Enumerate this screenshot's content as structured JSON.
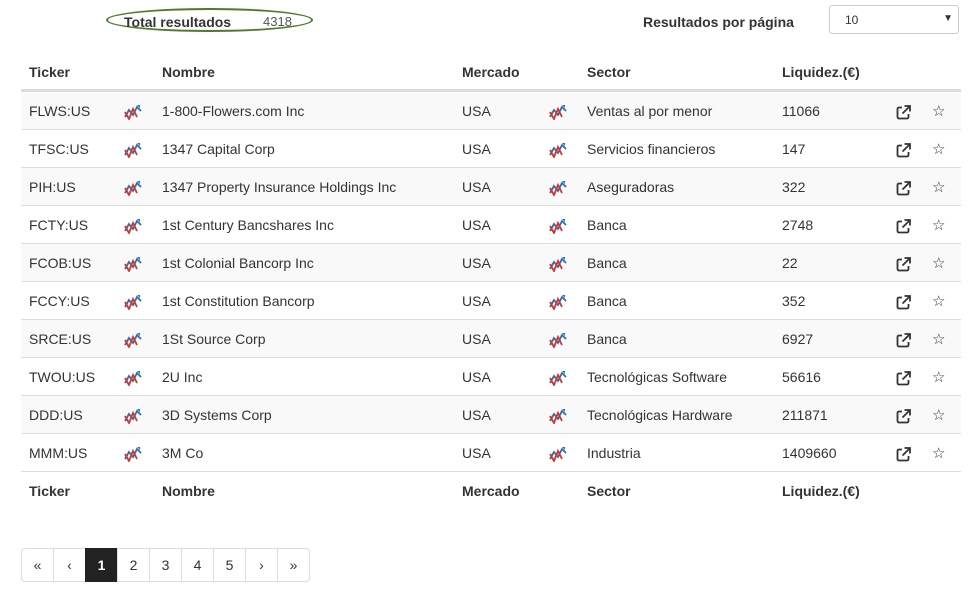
{
  "summary": {
    "total_label": "Total resultados",
    "total_value": "4318",
    "perpage_label": "Resultados por página",
    "perpage_value": "10"
  },
  "table": {
    "headers": {
      "ticker": "Ticker",
      "nombre": "Nombre",
      "mercado": "Mercado",
      "sector": "Sector",
      "liquidez": "Liquidez.(€)"
    },
    "rows": [
      {
        "ticker": "FLWS:US",
        "nombre": "1-800-Flowers.com Inc",
        "mercado": "USA",
        "sector": "Ventas al por menor",
        "liquidez": "11066"
      },
      {
        "ticker": "TFSC:US",
        "nombre": "1347 Capital Corp",
        "mercado": "USA",
        "sector": "Servicios financieros",
        "liquidez": "147"
      },
      {
        "ticker": "PIH:US",
        "nombre": "1347 Property Insurance Holdings Inc",
        "mercado": "USA",
        "sector": "Aseguradoras",
        "liquidez": "322"
      },
      {
        "ticker": "FCTY:US",
        "nombre": "1st Century Bancshares Inc",
        "mercado": "USA",
        "sector": "Banca",
        "liquidez": "2748"
      },
      {
        "ticker": "FCOB:US",
        "nombre": "1st Colonial Bancorp Inc",
        "mercado": "USA",
        "sector": "Banca",
        "liquidez": "22"
      },
      {
        "ticker": "FCCY:US",
        "nombre": "1st Constitution Bancorp",
        "mercado": "USA",
        "sector": "Banca",
        "liquidez": "352"
      },
      {
        "ticker": "SRCE:US",
        "nombre": "1St Source Corp",
        "mercado": "USA",
        "sector": "Banca",
        "liquidez": "6927"
      },
      {
        "ticker": "TWOU:US",
        "nombre": "2U Inc",
        "mercado": "USA",
        "sector": "Tecnológicas Software",
        "liquidez": "56616"
      },
      {
        "ticker": "DDD:US",
        "nombre": "3D Systems Corp",
        "mercado": "USA",
        "sector": "Tecnológicas Hardware",
        "liquidez": "211871"
      },
      {
        "ticker": "MMM:US",
        "nombre": "3M Co",
        "mercado": "USA",
        "sector": "Industria",
        "liquidez": "1409660"
      }
    ]
  },
  "pagination": {
    "items": [
      "«",
      "‹",
      "1",
      "2",
      "3",
      "4",
      "5",
      "›",
      "»"
    ],
    "active": "1"
  },
  "icons": {
    "chart": "chart-icon",
    "external": "external-link-icon",
    "star": "star-icon"
  },
  "colors": {
    "highlight_ellipse": "#4f7a2a",
    "chart_red": "#d9322a",
    "chart_blue": "#2a6fb0",
    "active_page": "#222222"
  }
}
